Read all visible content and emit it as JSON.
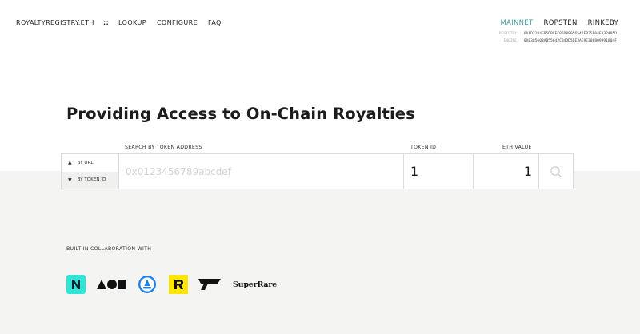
{
  "nav": {
    "brand": "ROYALTYREGISTRY.ETH",
    "separator": "::",
    "links": [
      "LOOKUP",
      "CONFIGURE",
      "FAQ"
    ]
  },
  "networks": {
    "items": [
      "MAINNET",
      "ROPSTEN",
      "RINKEBY"
    ],
    "active": "MAINNET",
    "active_color": "#3f9a9b"
  },
  "contracts": {
    "registry_label": "REGISTRY:",
    "registry_address": "0XAD2184FB5DBCFC05D8F056542FB25B04FA32A95D",
    "engine_label": "ENGINE:",
    "engine_address": "0X0385603AB55642CB4DD5DE3AE9E306809991804F"
  },
  "headline": "Providing Access to On-Chain Royalties",
  "search": {
    "address_label": "SEARCH BY TOKEN ADDRESS",
    "token_id_label": "TOKEN ID",
    "eth_value_label": "ETH VALUE",
    "mode_url": "BY URL",
    "mode_token": "BY TOKEN ID",
    "address_placeholder": "0x0123456789abcdef",
    "token_id_value": "1",
    "eth_value": "1"
  },
  "collaboration": {
    "label": "BUILT IN COLLABORATION WITH",
    "partners": [
      "nifty-gateway-logo",
      "async-art-logo",
      "opensea-logo",
      "rarible-logo",
      "foundation-logo",
      "superrare-logo"
    ],
    "superrare_text": "SuperRare"
  }
}
